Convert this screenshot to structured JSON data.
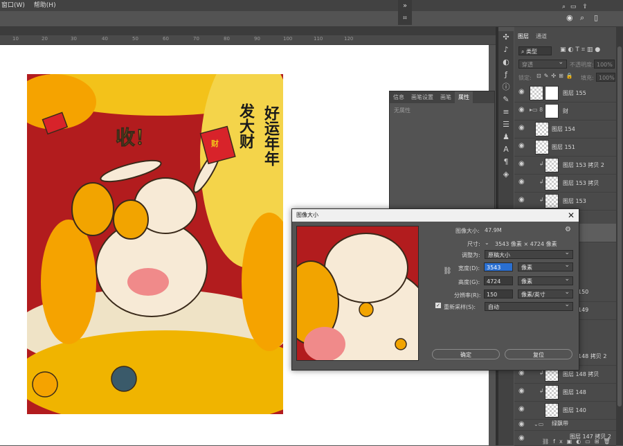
{
  "menubar": {
    "items": [
      "窗口(W)",
      "帮助(H)"
    ]
  },
  "ruler": {
    "ticks": [
      "10",
      "20",
      "30",
      "40",
      "50",
      "60",
      "70",
      "80",
      "90",
      "100",
      "110",
      "120"
    ]
  },
  "artwork": {
    "title": "好运年年",
    "subtitle": "发大财",
    "exclaim": "收！",
    "envelope_char": "财"
  },
  "properties_panel": {
    "tabs": [
      "信息",
      "画笔设置",
      "画笔",
      "属性"
    ],
    "active_tab": "属性",
    "body": "无属性"
  },
  "layers_panel": {
    "tabs": [
      "图层",
      "通道"
    ],
    "search_placeholder": "类型",
    "blend_mode": "穿透",
    "opacity_label": "不透明度:",
    "opacity_value": "100%",
    "lock_label": "锁定:",
    "fill_label": "填充:",
    "fill_value": "100%",
    "layers": [
      {
        "name": "图层 155"
      },
      {
        "name": "财"
      },
      {
        "name": "图层 154"
      },
      {
        "name": "图层 151"
      },
      {
        "name": "图层 153 拷贝 2"
      },
      {
        "name": "图层 153 拷贝"
      },
      {
        "name": "图层 153"
      },
      {
        "name": "150"
      },
      {
        "name": "149"
      },
      {
        "name": "148 拷贝 2"
      },
      {
        "name": "图层 148 拷贝"
      },
      {
        "name": "图层 148"
      },
      {
        "name": "图层 140"
      },
      {
        "name": "绿飘带"
      },
      {
        "name": "图层 147 拷贝 2"
      }
    ]
  },
  "dialog": {
    "title": "图像大小",
    "image_size_label": "图像大小:",
    "image_size_value": "47.9M",
    "dimensions_label": "尺寸:",
    "dimensions_value": "3543 像素 × 4724 像素",
    "fit_label": "调整为:",
    "fit_value": "原稿大小",
    "width_label": "宽度(D):",
    "width_value": "3543",
    "width_unit": "像素",
    "height_label": "高度(G):",
    "height_value": "4724",
    "height_unit": "像素",
    "resolution_label": "分辨率(R):",
    "resolution_value": "150",
    "resolution_unit": "像素/英寸",
    "resample_label": "重新采样(S):",
    "resample_value": "自动",
    "ok_label": "确定",
    "reset_label": "复位"
  }
}
